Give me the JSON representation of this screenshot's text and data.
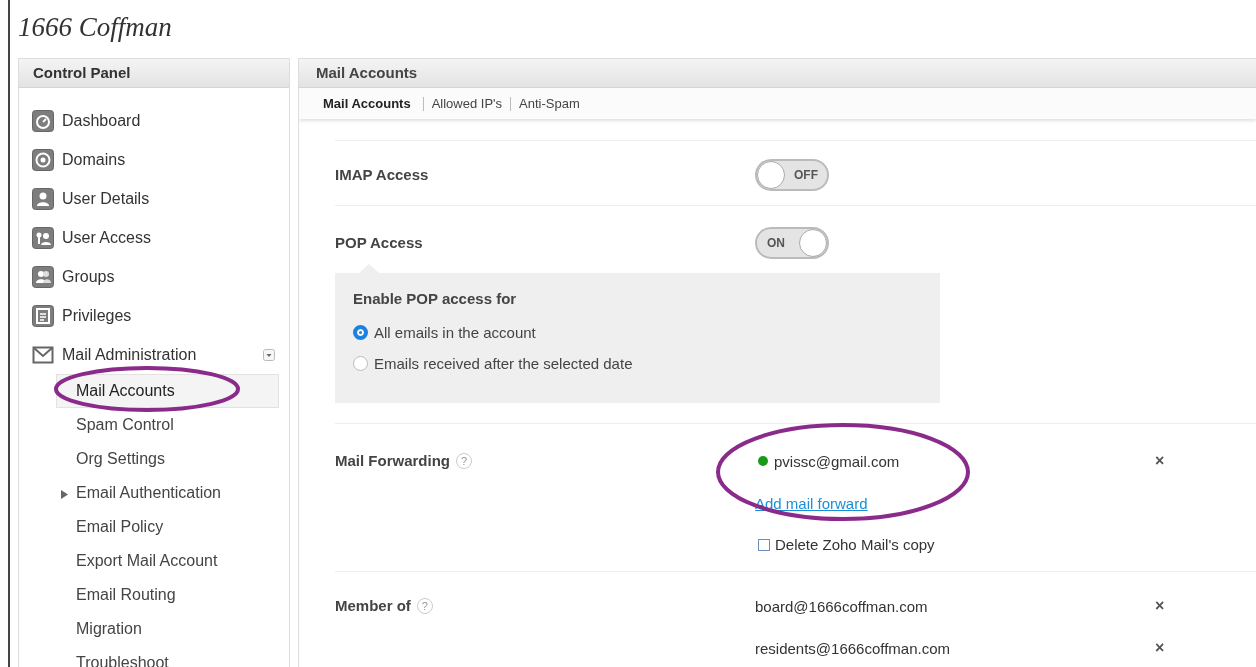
{
  "logo": "1666 Coffman",
  "sidebar": {
    "title": "Control Panel",
    "items": [
      {
        "label": "Dashboard",
        "kind": "dashboard"
      },
      {
        "label": "Domains",
        "kind": "domains"
      },
      {
        "label": "User Details",
        "kind": "user"
      },
      {
        "label": "User Access",
        "kind": "access"
      },
      {
        "label": "Groups",
        "kind": "groups"
      },
      {
        "label": "Privileges",
        "kind": "privileges"
      },
      {
        "label": "Mail Administration",
        "kind": "mail",
        "children": [
          {
            "label": "Mail Accounts",
            "kind": "page",
            "selected": true
          },
          {
            "label": "Spam Control",
            "kind": "page",
            "selected": false
          },
          {
            "label": "Org Settings",
            "kind": "page",
            "selected": false
          },
          {
            "label": "Email Authentication",
            "kind": "group",
            "selected": false
          },
          {
            "label": "Email Policy",
            "kind": "page",
            "selected": false
          },
          {
            "label": "Export Mail Account",
            "kind": "page",
            "selected": false
          },
          {
            "label": "Email Routing",
            "kind": "page",
            "selected": false
          },
          {
            "label": "Migration",
            "kind": "page",
            "selected": false
          },
          {
            "label": "Troubleshoot",
            "kind": "page",
            "selected": false
          }
        ]
      }
    ]
  },
  "main": {
    "title": "Mail Accounts",
    "tabs": [
      {
        "label": "Mail Accounts",
        "selected": true
      },
      {
        "label": "Allowed IP's",
        "selected": false
      },
      {
        "label": "Anti-Spam",
        "selected": false
      }
    ],
    "settings": [
      {
        "kind": "toggle",
        "label": "IMAP Access",
        "on": false,
        "toggle_text": "OFF"
      },
      {
        "kind": "toggle",
        "label": "POP Access",
        "on": true,
        "toggle_text": "ON",
        "options": {
          "heading": "Enable POP access for",
          "choices": [
            {
              "label": "All emails in the account",
              "selected": true
            },
            {
              "label": "Emails received after the selected date",
              "selected": false
            }
          ]
        }
      },
      {
        "kind": "list",
        "label": "Mail Forwarding",
        "help": "?",
        "entries": [
          {
            "text": "pvissc@gmail.com",
            "color": "#1a9a1a",
            "remove": "×"
          }
        ],
        "link": "Add mail forward",
        "checkbox": {
          "label": "Delete Zoho Mail's copy",
          "checked": false
        }
      },
      {
        "kind": "list",
        "label": "Member of",
        "help": "?",
        "entries": [
          {
            "text": "board@1666coffman.com",
            "remove": "×"
          },
          {
            "text": "residents@1666coffman.com",
            "remove": "×"
          }
        ]
      }
    ]
  }
}
